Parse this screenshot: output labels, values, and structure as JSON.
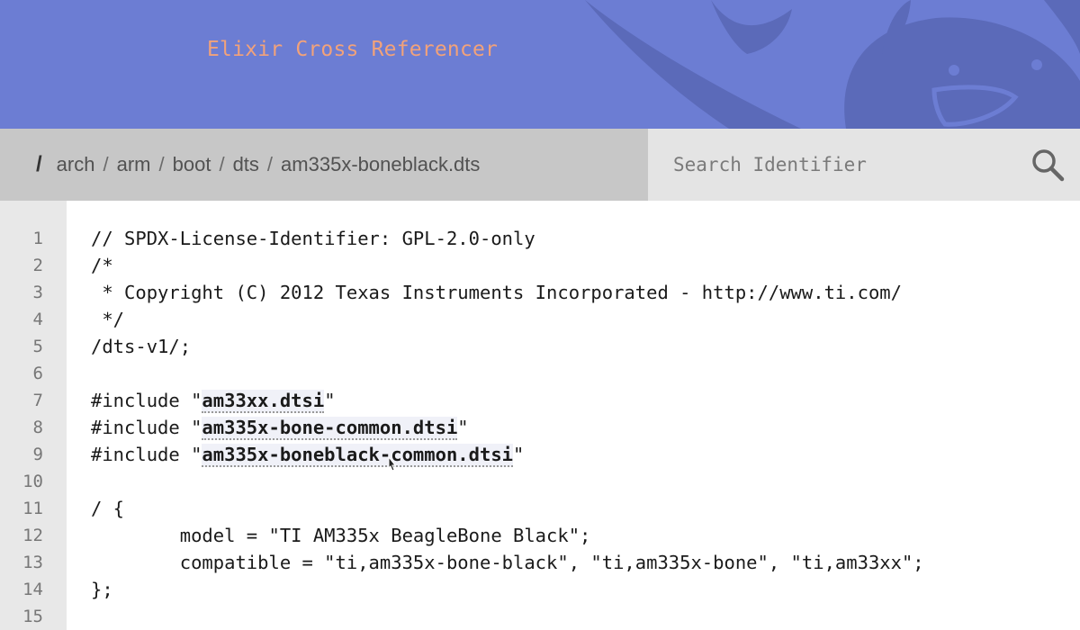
{
  "header": {
    "title": "Elixir Cross Referencer"
  },
  "breadcrumb": {
    "root": "/",
    "separator": "/",
    "items": [
      "arch",
      "arm",
      "boot",
      "dts",
      "am335x-boneblack.dts"
    ]
  },
  "search": {
    "placeholder": "Search Identifier",
    "icon": "search-icon"
  },
  "code": {
    "lines": [
      {
        "num": "1",
        "text": "// SPDX-License-Identifier: GPL-2.0-only"
      },
      {
        "num": "2",
        "text": "/*"
      },
      {
        "num": "3",
        "text": " * Copyright (C) 2012 Texas Instruments Incorporated - http://www.ti.com/"
      },
      {
        "num": "4",
        "text": " */"
      },
      {
        "num": "5",
        "text": "/dts-v1/;"
      },
      {
        "num": "6",
        "text": ""
      },
      {
        "num": "7",
        "pre": "#include \"",
        "link": "am33xx.dtsi",
        "post": "\""
      },
      {
        "num": "8",
        "pre": "#include \"",
        "link": "am335x-bone-common.dtsi",
        "post": "\""
      },
      {
        "num": "9",
        "pre": "#include \"",
        "link": "am335x-boneblack-common.dtsi",
        "post": "\""
      },
      {
        "num": "10",
        "text": ""
      },
      {
        "num": "11",
        "text": "/ {"
      },
      {
        "num": "12",
        "text": "        model = \"TI AM335x BeagleBone Black\";"
      },
      {
        "num": "13",
        "text": "        compatible = \"ti,am335x-bone-black\", \"ti,am335x-bone\", \"ti,am33xx\";"
      },
      {
        "num": "14",
        "text": "};"
      },
      {
        "num": "15",
        "text": ""
      }
    ]
  },
  "colors": {
    "header_bg": "#6c7dd3",
    "title": "#f2a27a",
    "breadcrumb_bg": "#c7c7c7",
    "search_bg": "#e4e4e4",
    "gutter_bg": "#e8e8e8"
  }
}
